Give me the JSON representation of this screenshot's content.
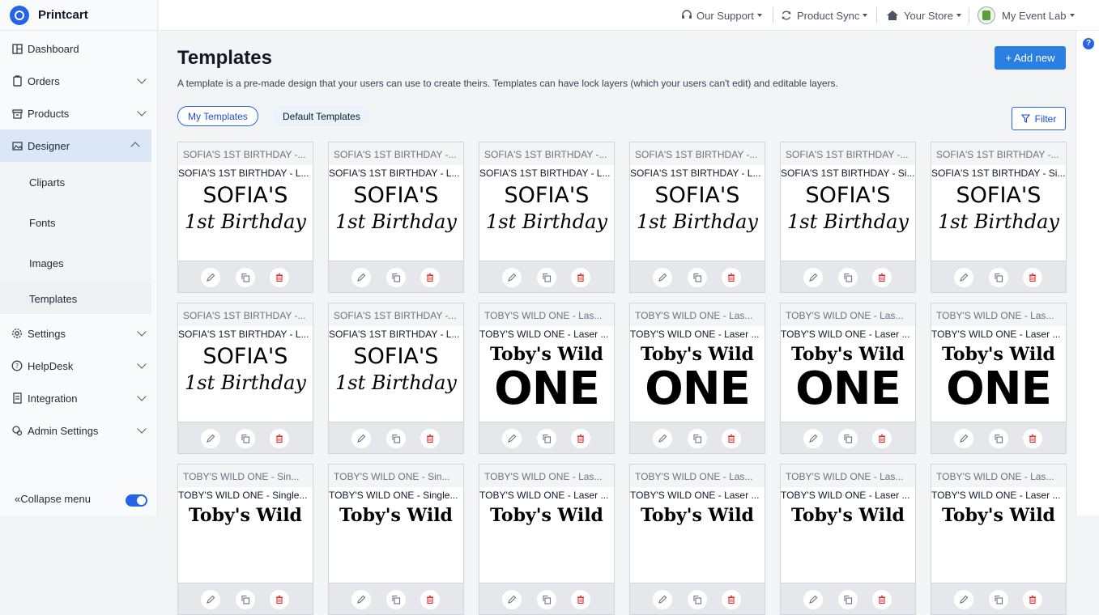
{
  "brand": {
    "name": "Printcart",
    "accent": "#2563eb"
  },
  "sidebar": {
    "items": [
      {
        "label": "Dashboard",
        "icon": "dashboard-icon"
      },
      {
        "label": "Orders",
        "icon": "orders-icon"
      },
      {
        "label": "Products",
        "icon": "products-icon"
      },
      {
        "label": "Designer",
        "icon": "designer-icon"
      }
    ],
    "designer_sub": [
      {
        "label": "Cliparts"
      },
      {
        "label": "Fonts"
      },
      {
        "label": "Images"
      },
      {
        "label": "Templates"
      }
    ],
    "items_after": [
      {
        "label": "Settings",
        "icon": "gear-icon"
      },
      {
        "label": "HelpDesk",
        "icon": "help-circle-icon"
      },
      {
        "label": "Integration",
        "icon": "integration-icon"
      },
      {
        "label": "Admin Settings",
        "icon": "admin-settings-icon"
      }
    ],
    "collapse_label": "Collapse menu"
  },
  "topbar": {
    "support": "Our Support",
    "sync": "Product Sync",
    "store": "Your Store",
    "account": "My Event Lab"
  },
  "page": {
    "title": "Templates",
    "description": "A template is a pre-made design that your users can use to create theirs. Templates can have lock layers (which your users can't edit) and editable layers.",
    "add_new": "+ Add new",
    "filter": "Filter",
    "tabs": [
      "My Templates",
      "Default Templates"
    ],
    "help": "?"
  },
  "templates": [
    {
      "name": "SOFIA'S 1ST BIRTHDAY -...",
      "subtitle": "SOFIA'S 1ST BIRTHDAY - L...",
      "line1": "SOFIA'S",
      "line2": "1st Birthday",
      "kind": "sofia"
    },
    {
      "name": "SOFIA'S 1ST BIRTHDAY -...",
      "subtitle": "SOFIA'S 1ST BIRTHDAY - L...",
      "line1": "SOFIA'S",
      "line2": "1st Birthday",
      "kind": "sofia"
    },
    {
      "name": "SOFIA'S 1ST BIRTHDAY -...",
      "subtitle": "SOFIA'S 1ST BIRTHDAY - L...",
      "line1": "SOFIA'S",
      "line2": "1st Birthday",
      "kind": "sofia"
    },
    {
      "name": "SOFIA'S 1ST BIRTHDAY -...",
      "subtitle": "SOFIA'S 1ST BIRTHDAY - L...",
      "line1": "SOFIA'S",
      "line2": "1st Birthday",
      "kind": "sofia"
    },
    {
      "name": "SOFIA'S 1ST BIRTHDAY -...",
      "subtitle": "SOFIA'S 1ST BIRTHDAY - Si...",
      "line1": "SOFIA'S",
      "line2": "1st Birthday",
      "kind": "sofia"
    },
    {
      "name": "SOFIA'S 1ST BIRTHDAY -...",
      "subtitle": "SOFIA'S 1ST BIRTHDAY - Si...",
      "line1": "SOFIA'S",
      "line2": "1st Birthday",
      "kind": "sofia"
    },
    {
      "name": "SOFIA'S 1ST BIRTHDAY -...",
      "subtitle": "SOFIA'S 1ST BIRTHDAY - L...",
      "line1": "SOFIA'S",
      "line2": "1st Birthday",
      "kind": "sofia"
    },
    {
      "name": "SOFIA'S 1ST BIRTHDAY -...",
      "subtitle": "SOFIA'S 1ST BIRTHDAY - L...",
      "line1": "SOFIA'S",
      "line2": "1st Birthday",
      "kind": "sofia"
    },
    {
      "name": "TOBY'S WILD ONE - Las...",
      "subtitle": "TOBY'S WILD ONE - Laser ...",
      "line1": "Toby's Wild",
      "line2": "ONE",
      "kind": "toby"
    },
    {
      "name": "TOBY'S WILD ONE - Las...",
      "subtitle": "TOBY'S WILD ONE - Laser ...",
      "line1": "Toby's Wild",
      "line2": "ONE",
      "kind": "toby"
    },
    {
      "name": "TOBY'S WILD ONE - Las...",
      "subtitle": "TOBY'S WILD ONE - Laser ...",
      "line1": "Toby's Wild",
      "line2": "ONE",
      "kind": "toby"
    },
    {
      "name": "TOBY'S WILD ONE - Las...",
      "subtitle": "TOBY'S WILD ONE - Laser ...",
      "line1": "Toby's Wild",
      "line2": "ONE",
      "kind": "toby"
    },
    {
      "name": "TOBY'S WILD ONE - Sin...",
      "subtitle": "TOBY'S WILD ONE - Single...",
      "line1": "Toby's Wild",
      "line2": "",
      "kind": "toby"
    },
    {
      "name": "TOBY'S WILD ONE - Sin...",
      "subtitle": "TOBY'S WILD ONE - Single...",
      "line1": "Toby's Wild",
      "line2": "",
      "kind": "toby"
    },
    {
      "name": "TOBY'S WILD ONE - Las...",
      "subtitle": "TOBY'S WILD ONE - Laser ...",
      "line1": "Toby's Wild",
      "line2": "",
      "kind": "toby"
    },
    {
      "name": "TOBY'S WILD ONE - Las...",
      "subtitle": "TOBY'S WILD ONE - Laser ...",
      "line1": "Toby's Wild",
      "line2": "",
      "kind": "toby"
    },
    {
      "name": "TOBY'S WILD ONE - Las...",
      "subtitle": "TOBY'S WILD ONE - Laser ...",
      "line1": "Toby's Wild",
      "line2": "",
      "kind": "toby"
    },
    {
      "name": "TOBY'S WILD ONE - Las...",
      "subtitle": "TOBY'S WILD ONE - Laser ...",
      "line1": "Toby's Wild",
      "line2": "",
      "kind": "toby"
    }
  ]
}
